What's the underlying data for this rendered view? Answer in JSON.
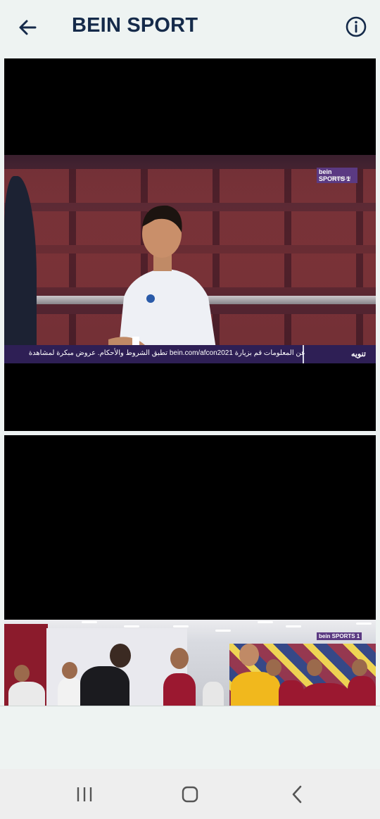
{
  "appbar": {
    "title": "BEIN SPORT",
    "back_icon": "arrow-left-icon",
    "info_icon": "info-circle-icon"
  },
  "video1": {
    "channel_logo": "bein SPORTS 1",
    "channel_sub": "PREMIUM",
    "ticker_label": "تنويه",
    "ticker_text": "عن المعلومات قم بزيارة bein.com/afcon2021 تطبق الشروط والأحكام.   عروض مبكرة لمشاهدة"
  },
  "video2": {
    "channel_logo": "bein SPORTS 1"
  },
  "navbar": {
    "recent_icon": "recent-apps-icon",
    "home_icon": "home-icon",
    "back_icon": "back-chevron-icon"
  },
  "colors": {
    "title": "#152a4a",
    "background": "#eef3f2",
    "video_bg": "#000000",
    "ticker_bg": "#2e1f55"
  }
}
